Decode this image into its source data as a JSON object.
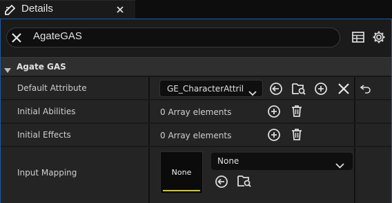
{
  "tab": {
    "title": "Details",
    "icon": "pencil-edit-icon",
    "close_icon": "close-icon"
  },
  "search": {
    "value": "AgateGAS",
    "clear_icon": "close-icon"
  },
  "toolbar": {
    "icons": [
      "table-view-icon",
      "gear-icon"
    ]
  },
  "category": {
    "label": "Agate GAS",
    "expanded": true
  },
  "properties": {
    "default_attribute": {
      "label": "Default Attribute",
      "value": "GE_CharacterAttril",
      "icons": [
        "use-selected-arrow-icon",
        "browse-folder-icon",
        "add-icon",
        "clear-icon",
        "reset-arrow-icon"
      ]
    },
    "initial_abilities": {
      "label": "Initial Abilities",
      "value": "0 Array elements",
      "icons": [
        "add-icon",
        "trash-icon"
      ]
    },
    "initial_effects": {
      "label": "Initial Effects",
      "value": "0 Array elements",
      "icons": [
        "add-icon",
        "trash-icon"
      ]
    },
    "input_mapping": {
      "label": "Input Mapping",
      "thumbnail_label": "None",
      "value": "None",
      "icons": [
        "use-selected-arrow-icon",
        "browse-folder-icon"
      ]
    }
  },
  "colors": {
    "panel_border": "#1e5aa8",
    "thumbnail_bar": "#c9c832"
  }
}
